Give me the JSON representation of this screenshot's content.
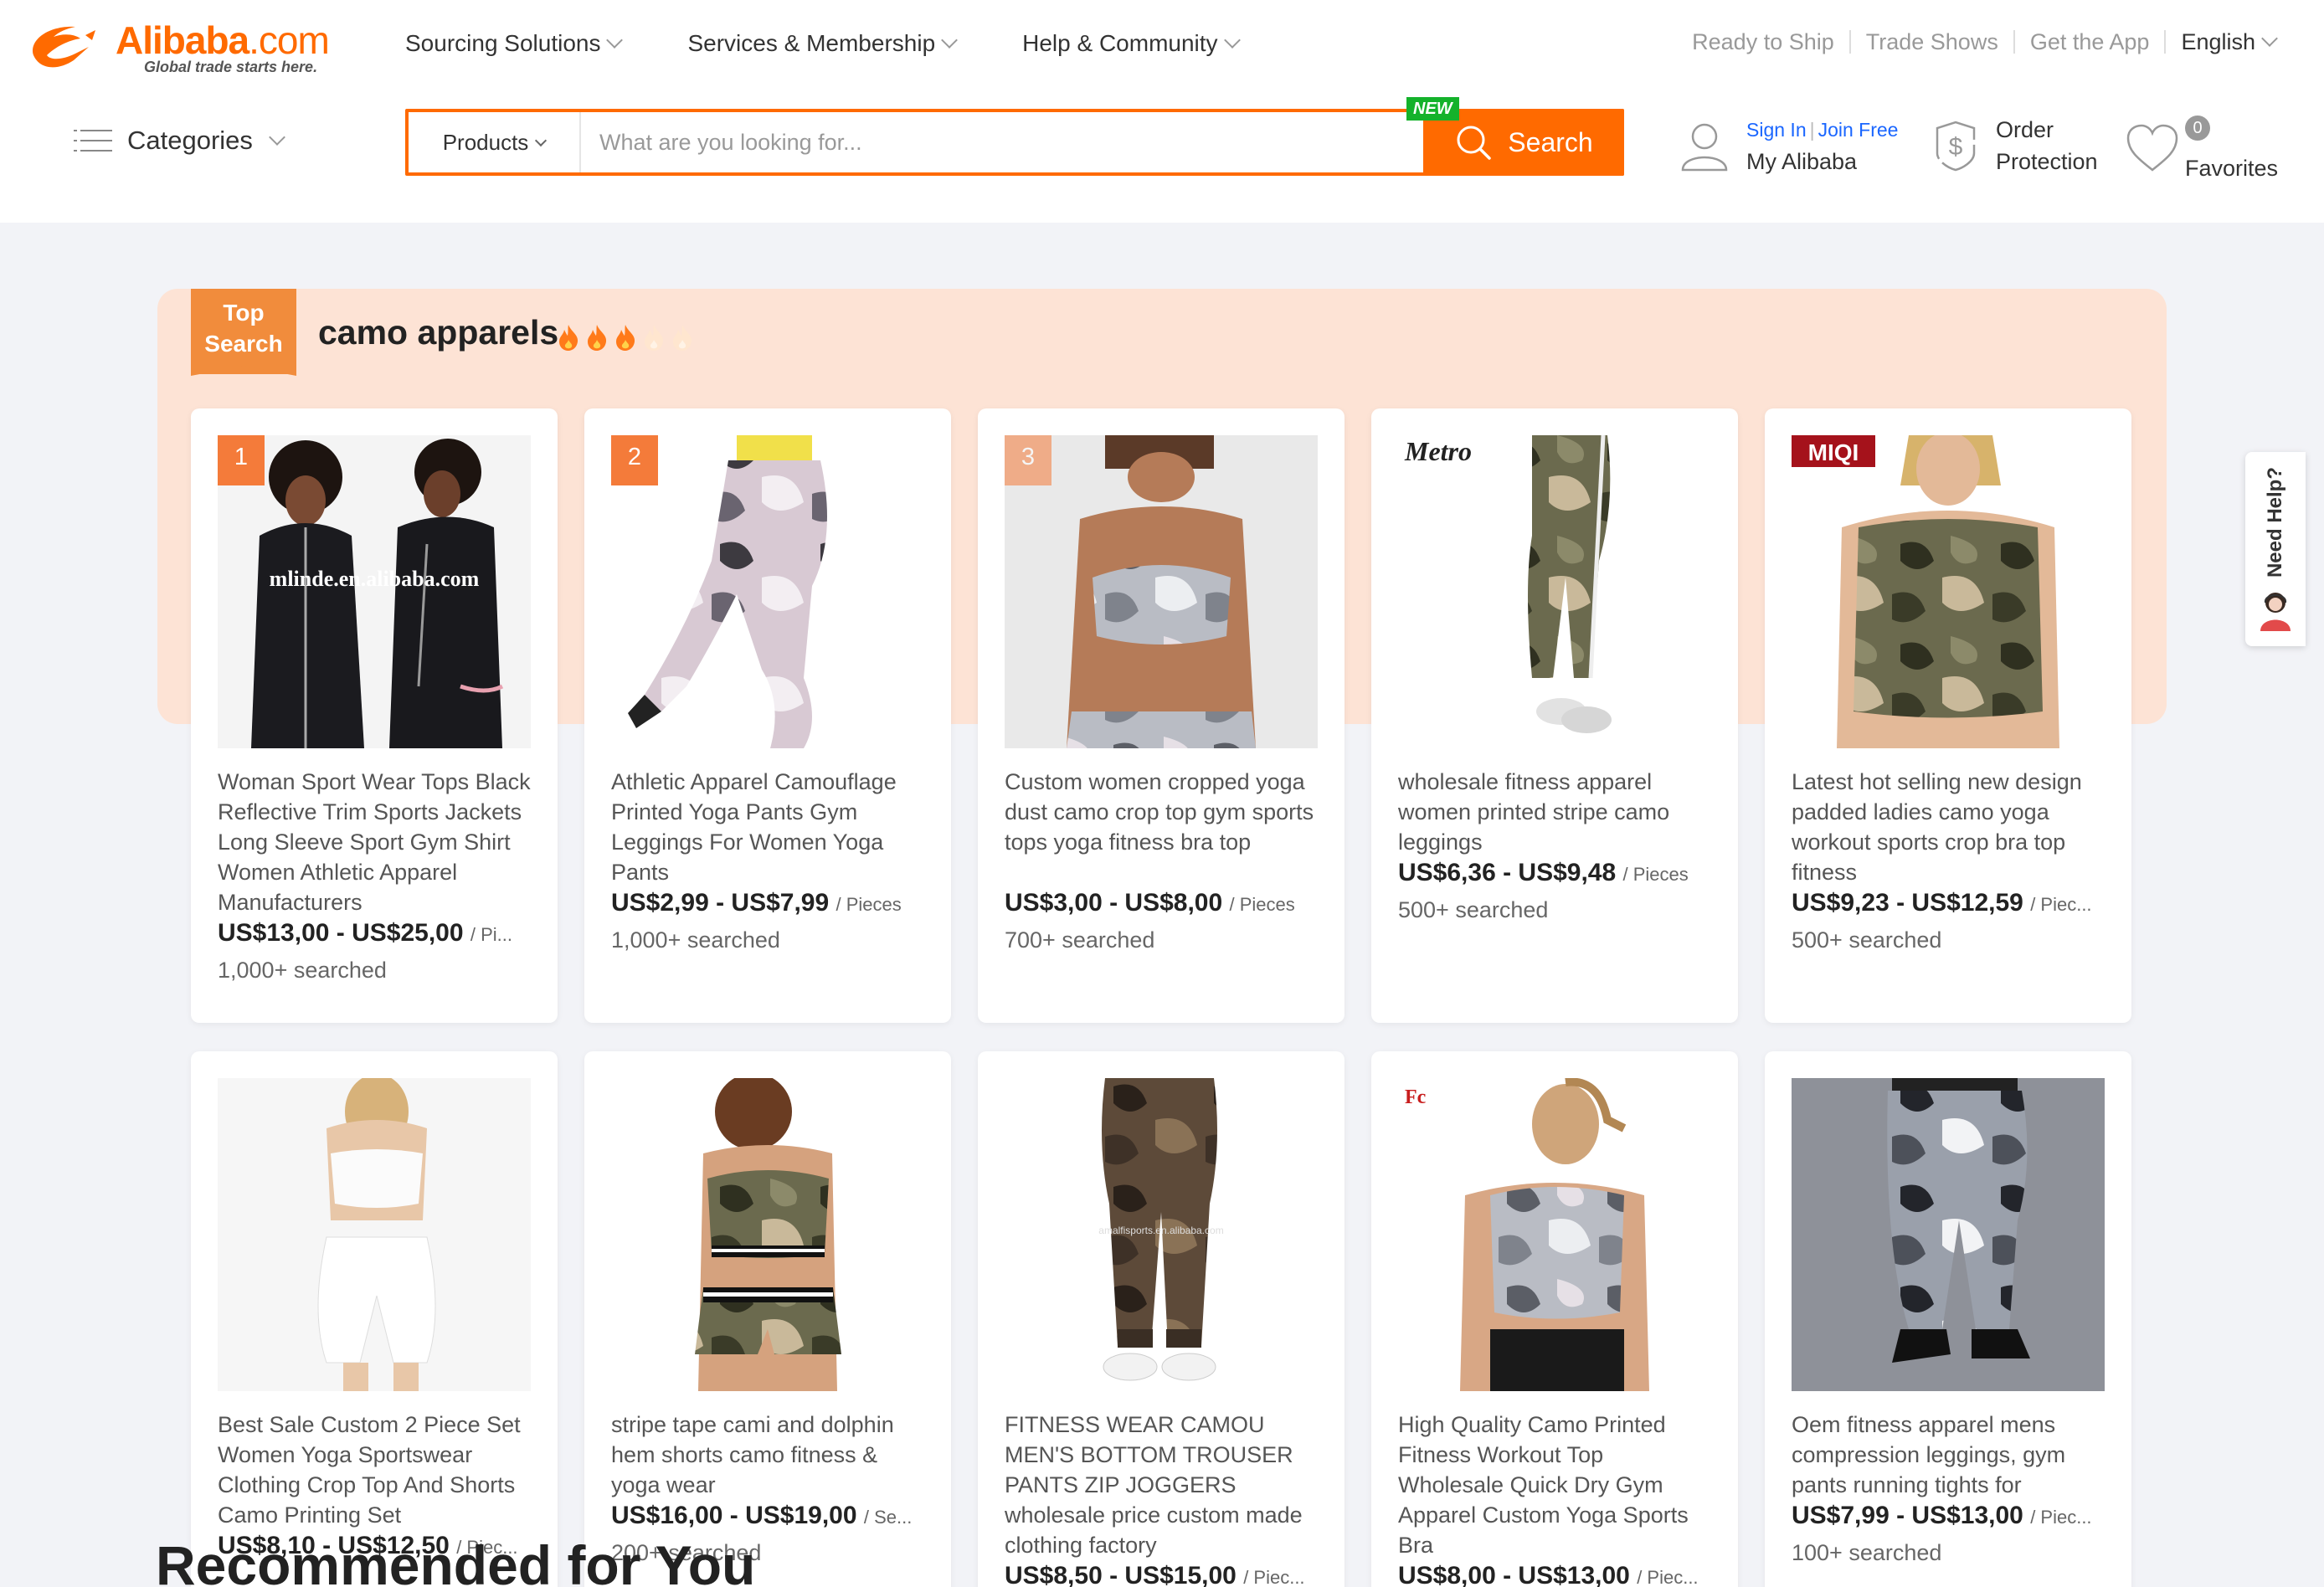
{
  "brand": {
    "name": "Alibaba",
    "domain": ".com",
    "tagline": "Global trade starts here."
  },
  "topnav": [
    {
      "label": "Sourcing Solutions"
    },
    {
      "label": "Services & Membership"
    },
    {
      "label": "Help & Community"
    }
  ],
  "toplinks": {
    "ready_to_ship": "Ready to Ship",
    "trade_shows": "Trade Shows",
    "get_app": "Get the App",
    "language": "English"
  },
  "categories_label": "Categories",
  "search": {
    "category": "Products",
    "placeholder": "What are you looking for...",
    "button": "Search",
    "new_badge": "NEW"
  },
  "account": {
    "sign_in": "Sign In",
    "join_free": "Join Free",
    "my_alibaba": "My Alibaba"
  },
  "order_protection": {
    "line1": "Order",
    "line2": "Protection"
  },
  "favorites": {
    "count": "0",
    "label": "Favorites"
  },
  "top_search": {
    "ribbon_line1": "Top",
    "ribbon_line2": "Search",
    "title": "camo apparels",
    "heat_level": 3,
    "heat_max": 5
  },
  "products": [
    {
      "rank": "1",
      "title": "Woman Sport Wear Tops Black Reflective Trim Sports Jackets Long Sleeve Sport Gym Shirt Women Athletic Apparel Manufacturers",
      "price": "US$13,00 - US$25,00",
      "unit": "/ Pi...",
      "searched": "1,000+ searched",
      "watermark": "mlinde.en.alibaba.com"
    },
    {
      "rank": "2",
      "title": "Athletic Apparel Camouflage Printed Yoga Pants Gym Leggings For Women Yoga Pants",
      "price": "US$2,99 - US$7,99",
      "unit": "/ Pieces",
      "searched": "1,000+ searched"
    },
    {
      "rank": "3",
      "title": "Custom women cropped yoga dust camo crop top gym sports tops yoga fitness bra top",
      "price": "US$3,00 - US$8,00",
      "unit": "/ Pieces",
      "searched": "700+ searched"
    },
    {
      "rank": "",
      "title": "wholesale fitness apparel women printed stripe camo leggings",
      "price": "US$6,36 - US$9,48",
      "unit": "/ Pieces",
      "searched": "500+ searched",
      "brand": "Metro"
    },
    {
      "rank": "",
      "title": "Latest hot selling new design padded ladies camo yoga workout sports crop bra top fitness",
      "price": "US$9,23 - US$12,59",
      "unit": "/ Piec...",
      "searched": "500+ searched",
      "brand": "MIQI"
    },
    {
      "rank": "",
      "title": "Best Sale Custom 2 Piece Set Women Yoga Sportswear Clothing Crop Top And Shorts Camo Printing Set",
      "price": "US$8,10 - US$12,50",
      "unit": "/ Piec...",
      "searched": ""
    },
    {
      "rank": "",
      "title": "stripe tape cami and dolphin hem shorts camo fitness & yoga wear",
      "price": "US$16,00 - US$19,00",
      "unit": "/ Se...",
      "searched": "200+ searched"
    },
    {
      "rank": "",
      "title": "FITNESS WEAR CAMOU MEN'S BOTTOM TROUSER PANTS ZIP JOGGERS wholesale price custom made clothing factory",
      "price": "US$8,50 - US$15,00",
      "unit": "/ Piec...",
      "searched": ""
    },
    {
      "rank": "",
      "title": "High Quality Camo Printed Fitness Workout Top Wholesale Quick Dry Gym Apparel Custom Yoga Sports Bra",
      "price": "US$8,00 - US$13,00",
      "unit": "/ Piec...",
      "searched": "",
      "brand": "Fc"
    },
    {
      "rank": "",
      "title": "Oem fitness apparel mens compression leggings, gym pants running tights for",
      "price": "US$7,99 - US$13,00",
      "unit": "/ Piec...",
      "searched": "100+ searched"
    }
  ],
  "need_help": "Need Help?",
  "recommended_title": "Recommended for You",
  "colors": {
    "brand_orange": "#ff6a00",
    "top_search_bg": "#fde3d5",
    "ribbon": "#f18c3c",
    "link_blue": "#1a66ff",
    "new_green": "#14b22b"
  }
}
